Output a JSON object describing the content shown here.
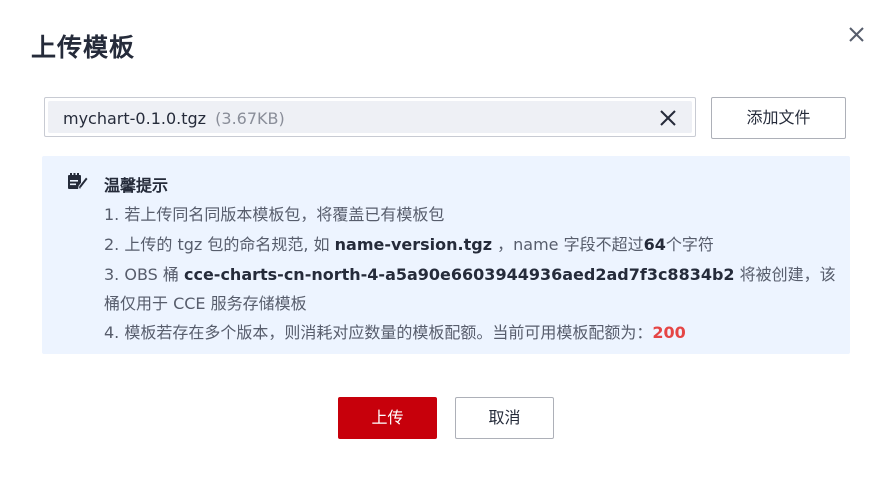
{
  "dialog": {
    "title": "上传模板",
    "close_icon": "close-icon"
  },
  "file": {
    "name": "mychart-0.1.0.tgz",
    "size": "(3.67KB)",
    "clear_icon": "clear-icon"
  },
  "add_file_button": "添加文件",
  "tips": {
    "icon": "notepad-pen-icon",
    "title": "温馨提示",
    "line1": "1. 若上传同名同版本模板包，将覆盖已有模板包",
    "line2_pre": "2. 上传的 tgz 包的命名规范, 如 ",
    "line2_bold": "name-version.tgz",
    "line2_mid": " ，name 字段不超过",
    "line2_num": "64",
    "line2_post": "个字符",
    "line3_pre": "3. OBS 桶 ",
    "line3_bold": "cce-charts-cn-north-4-a5a90e6603944936aed2ad7f3c8834b2",
    "line3_post": " 将被创建，该",
    "line3b": "桶仅用于 CCE 服务存储模板",
    "line4_pre": "4. 模板若存在多个版本，则消耗对应数量的模板配额。当前可用模板配额为：",
    "line4_quota": "200"
  },
  "footer": {
    "upload_label": "上传",
    "cancel_label": "取消"
  },
  "colors": {
    "primary": "#c7000b",
    "tips_bg": "#edf4ff",
    "quota": "#e54545"
  }
}
